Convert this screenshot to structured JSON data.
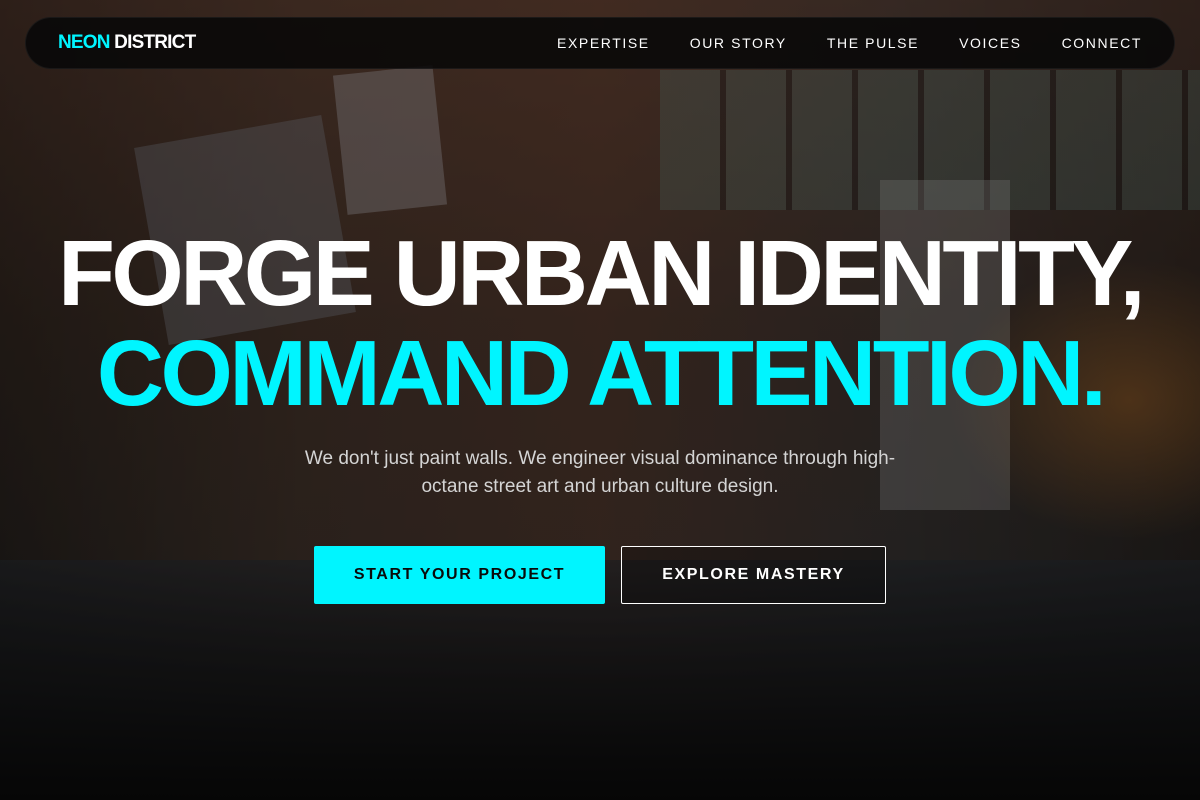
{
  "brand": {
    "accent": "NEON",
    "rest": " DISTRICT"
  },
  "nav": {
    "items": [
      {
        "label": "EXPERTISE"
      },
      {
        "label": "OUR STORY"
      },
      {
        "label": "THE PULSE"
      },
      {
        "label": "VOICES"
      },
      {
        "label": "CONNECT"
      }
    ]
  },
  "hero": {
    "headline_line1": "FORGE URBAN IDENTITY,",
    "headline_line2": "COMMAND ATTENTION.",
    "subtext": "We don't just paint walls. We engineer visual dominance through high-octane street art and urban culture design.",
    "primary_cta": "START YOUR PROJECT",
    "secondary_cta": "EXPLORE MASTERY"
  },
  "colors": {
    "accent": "#00f5ff",
    "nav_bg": "#080808",
    "text": "#ffffff"
  }
}
